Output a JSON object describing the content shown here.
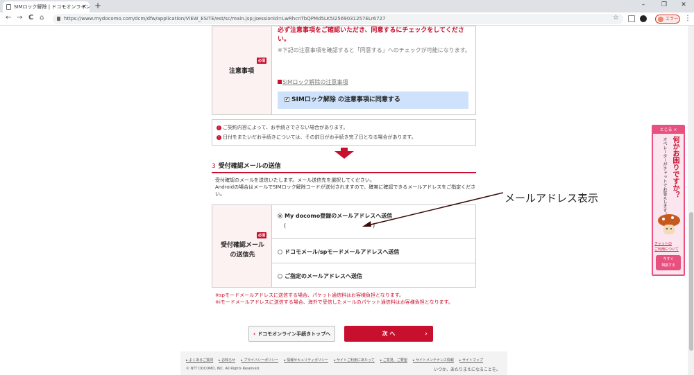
{
  "browser": {
    "tab_title": "SIMロック解除 | ドコモオンライン手続",
    "tab_close": "×",
    "new_tab": "+",
    "url": "https://www.mydocomo.com/dcm/dfw/application/VIEW_ESITE/est/sc/main.jsp;jsessionid=LwRhcnTbQPMd5LK5I2569031257ELr6727",
    "error_chip": "エラー",
    "win_min": "–",
    "win_max": "❐",
    "win_close": "✕",
    "back": "←",
    "forward": "→",
    "reload": "C",
    "home": "⌂",
    "star": "☆",
    "menu": "⋮"
  },
  "notice": {
    "label": "注意事項",
    "required": "必須",
    "bold_line": "必ず注意事項をご確認いただき、同意するにチェックをしてください。",
    "hint": "※下記の注意事項を確認すると「同意する」へのチェックが可能になります。",
    "link": "SIMロック解除の注意事項",
    "agree": "SIMロック解除 の注意事項に同意する"
  },
  "warnings": [
    "ご契約内容によって、お手続きできない場合があります。",
    "日付をまたいだお手続きについては、その前日がお手続き完了日となる場合があります。"
  ],
  "section3": {
    "number": "3",
    "title": "受付確認メールの送信",
    "desc1": "受付確認のメールを送信いたします。メール送信先を選択してください。",
    "desc2": "Androidの場合はメールでSIMロック解除コードが送付されますので、確実に確認できるメールアドレスをご指定ください。",
    "label_line1": "受付確認メール",
    "label_line2": "の送信先",
    "required": "必須",
    "options": [
      "My docomo登録のメールアドレスへ送信",
      "ドコモメール/spモードメールアドレスへ送信",
      "ご指定のメールアドレスへ送信"
    ],
    "paren_open": "(",
    "paren_close": ")",
    "note1": "※spモードメールアドレスに送信する場合、パケット通信料はお客様負担となります。",
    "note2": "※iモードメールアドレスに送信する場合、海外で受信したメールのパケット通信料はお客様負担となります。"
  },
  "annotation": "メールアドレス表示",
  "buttons": {
    "back": "ドコモオンライン手続きトップへ",
    "next": "次 へ"
  },
  "footer": {
    "links": [
      "よくあるご質問",
      "お知らせ",
      "プライバシーポリシー",
      "情報セキュリティポリシー",
      "サイトご利用にあたって",
      "ご意見、ご要望",
      "サイトメンテナンス情報",
      "サイトマップ"
    ],
    "copyright": "© NTT DOCOMO, INC. All Rights Reserved.",
    "tagline": "いつか、あたりまえになることを。"
  },
  "side_panel": {
    "close": "とじる ×",
    "title": "何かお困りですか？",
    "sub": "オペレーターがチャットでお答えします。",
    "chat_link1": "チャットの",
    "chat_link2": "ご利用について",
    "cta1": "今すぐ",
    "cta2": "相談する"
  },
  "colors": {
    "brand": "#c8102e",
    "agree_bg": "#cfe2fb",
    "label_bg": "#fdf2f2"
  }
}
